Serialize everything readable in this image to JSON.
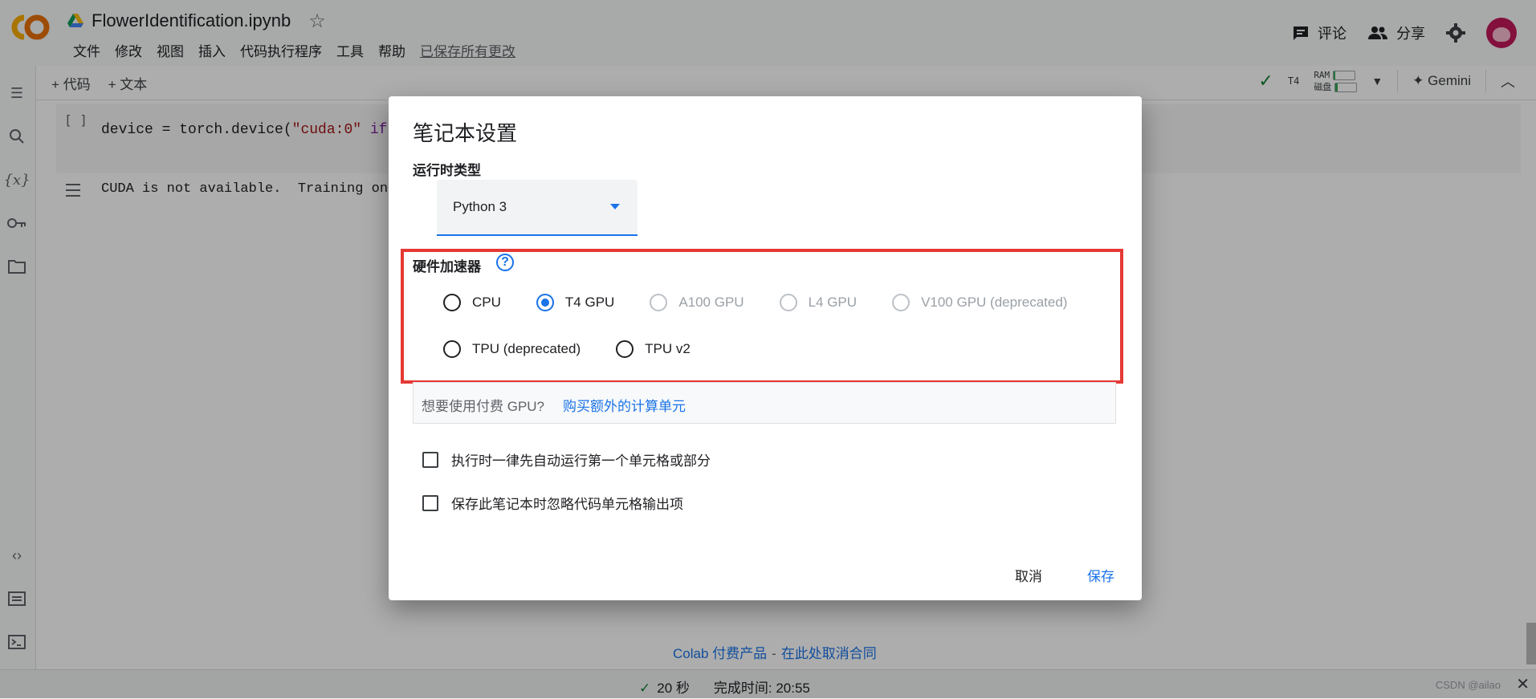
{
  "header": {
    "doc_title": "FlowerIdentification.ipynb",
    "menu": [
      "文件",
      "修改",
      "视图",
      "插入",
      "代码执行程序",
      "工具",
      "帮助"
    ],
    "saved_status": "已保存所有更改",
    "comment_label": "评论",
    "share_label": "分享"
  },
  "toolbar": {
    "add_code": "+ 代码",
    "add_text": "+ 文本",
    "runtime_gpu": "T4",
    "ram_label": "RAM",
    "disk_label": "磁盘",
    "gemini_label": "Gemini"
  },
  "notebook": {
    "cell_bracket": "[ ]",
    "code_prefix": "device = torch.device(",
    "code_string": "\"cuda:0\"",
    "code_kw": " if",
    "output_text": "CUDA is not available.  Training on c"
  },
  "dialog": {
    "title": "笔记本设置",
    "runtime_type_label": "运行时类型",
    "runtime_type_value": "Python 3",
    "accelerator_label": "硬件加速器",
    "accelerator_options_row1": [
      {
        "label": "CPU",
        "state": "unchecked"
      },
      {
        "label": "T4 GPU",
        "state": "checked"
      },
      {
        "label": "A100 GPU",
        "state": "disabled"
      },
      {
        "label": "L4 GPU",
        "state": "disabled"
      },
      {
        "label": "V100 GPU (deprecated)",
        "state": "disabled"
      }
    ],
    "accelerator_options_row2": [
      {
        "label": "TPU (deprecated)",
        "state": "unchecked"
      },
      {
        "label": "TPU v2",
        "state": "unchecked"
      }
    ],
    "paid_question": "想要使用付费 GPU?",
    "paid_link": "购买额外的计算单元",
    "option_autorun": "执行时一律先自动运行第一个单元格或部分",
    "option_omit_output": "保存此笔记本时忽略代码单元格输出项",
    "cancel_label": "取消",
    "save_label": "保存"
  },
  "footer": {
    "link_paid": "Colab 付费产品",
    "dash": "-",
    "link_cancel": "在此处取消合同"
  },
  "status": {
    "duration": "20 秒",
    "completed": "完成时间:  20:55",
    "watermark": "CSDN @ailao"
  },
  "colors": {
    "accent": "#1a73e8",
    "highlight": "#e53935",
    "success": "#188038"
  }
}
